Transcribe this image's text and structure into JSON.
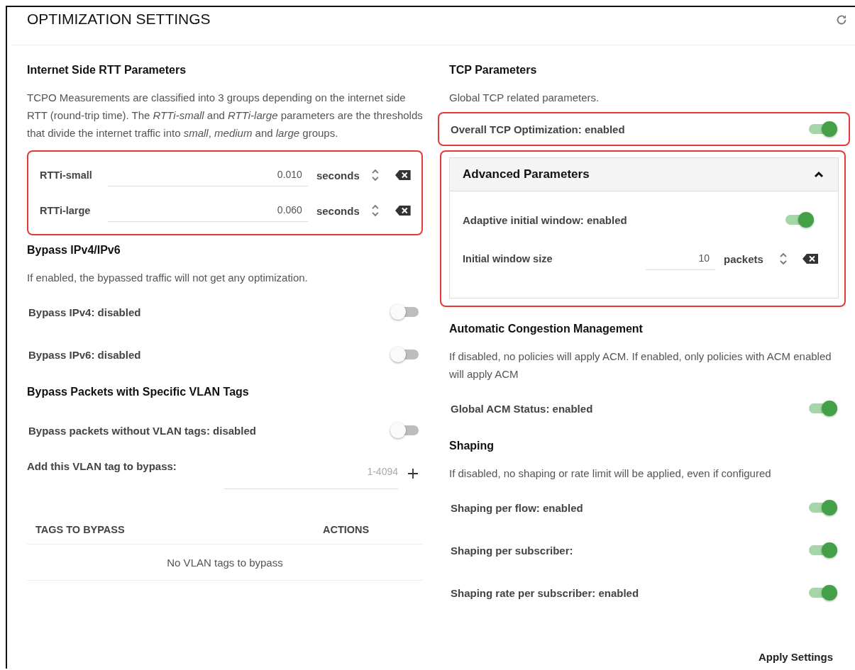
{
  "title": "OPTIMIZATION SETTINGS",
  "columns": [
    [
      {
        "heading": "Internet Side RTT Parameters",
        "description": "TCPO Measurements are classified into 3 groups depending on the internet side RTT (round-trip time). The *RTTi-small* and *RTTi-large* parameters are the thresholds that divide the internet traffic into *small*, *medium* and *large* groups.",
        "items": [
          {
            "kind": "param_group",
            "highlighted": true,
            "params": [
              {
                "label": "RTTi-small",
                "value": "0.010",
                "unit": "seconds"
              },
              {
                "label": "RTTi-large",
                "value": "0.060",
                "unit": "seconds"
              }
            ]
          }
        ]
      },
      {
        "heading": "Bypass IPv4/IPv6",
        "description": "If enabled, the bypassed traffic will not get any optimization.",
        "items": [
          {
            "kind": "toggle",
            "label": "Bypass IPv4: disabled",
            "on": false,
            "highlighted": false
          },
          {
            "kind": "toggle",
            "label": "Bypass IPv6: disabled",
            "on": false,
            "highlighted": false
          }
        ]
      },
      {
        "heading": "Bypass Packets with Specific VLAN Tags",
        "items": [
          {
            "kind": "toggle",
            "label": "Bypass packets without VLAN tags: disabled",
            "on": false,
            "highlighted": false
          },
          {
            "kind": "add_tag",
            "label": "Add this VLAN tag to bypass:",
            "placeholder": "1-4094"
          },
          {
            "kind": "table",
            "columns": [
              "TAGS TO BYPASS",
              "ACTIONS"
            ],
            "empty_text": "No VLAN tags to bypass"
          }
        ]
      }
    ],
    [
      {
        "heading": "TCP Parameters",
        "description": "Global TCP related parameters.",
        "items": [
          {
            "kind": "toggle",
            "label": "Overall TCP Optimization: enabled",
            "on": true,
            "highlighted": true
          },
          {
            "kind": "panel",
            "title": "Advanced Parameters",
            "expanded": true,
            "highlighted": true,
            "items": [
              {
                "kind": "toggle",
                "label": "Adaptive initial window: enabled",
                "on": true
              },
              {
                "kind": "param",
                "label": "Initial window size",
                "value": "10",
                "unit": "packets"
              }
            ]
          }
        ]
      },
      {
        "heading": "Automatic Congestion Management",
        "description": "If disabled, no policies will apply ACM. If enabled, only policies with ACM enabled will apply ACM",
        "items": [
          {
            "kind": "toggle",
            "label": "Global ACM Status: enabled",
            "on": true,
            "highlighted": false
          }
        ]
      },
      {
        "heading": "Shaping",
        "description": "If disabled, no shaping or rate limit will be applied, even if configured",
        "items": [
          {
            "kind": "toggle",
            "label": "Shaping per flow: enabled",
            "on": true,
            "highlighted": false
          },
          {
            "kind": "toggle",
            "label": "Shaping per subscriber:",
            "on": true,
            "highlighted": false
          },
          {
            "kind": "toggle",
            "label": "Shaping rate per subscriber: enabled",
            "on": true,
            "highlighted": false
          }
        ]
      }
    ]
  ],
  "apply_button": "Apply Settings"
}
